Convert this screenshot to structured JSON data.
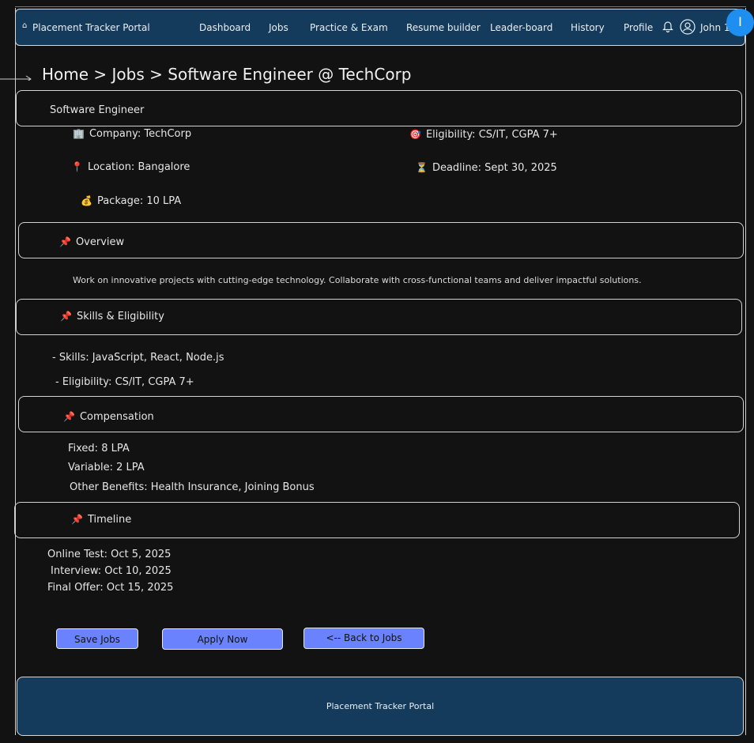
{
  "nav": {
    "brand_icon": "⌂",
    "brand": "Placement Tracker Portal",
    "items": [
      "Dashboard",
      "Jobs",
      "Practice & Exam",
      "Resume builder",
      "Leader-board",
      "History",
      "Profile"
    ],
    "username": "John 1",
    "badge": "I"
  },
  "breadcrumb": "Home > Jobs > Software Engineer @ TechCorp",
  "job": {
    "title": "Software Engineer",
    "company": "Company: TechCorp",
    "location": "Location: Bangalore",
    "package": "Package: 10 LPA",
    "eligibility": "Eligibility: CS/IT, CGPA 7+",
    "deadline": "Deadline: Sept 30, 2025",
    "icons": {
      "company": "🏢",
      "location": "📍",
      "package": "💰",
      "eligibility": "🎯",
      "deadline": "⏳"
    }
  },
  "overview": {
    "title": "Overview",
    "text": "Work on innovative projects with cutting-edge technology. Collaborate with cross-functional teams and deliver impactful solutions."
  },
  "skills": {
    "title": "Skills & Eligibility",
    "items": [
      "-  Skills: JavaScript, React, Node.js",
      "-  Eligibility: CS/IT, CGPA 7+"
    ]
  },
  "compensation": {
    "title": "Compensation",
    "items": [
      "Fixed: 8 LPA",
      "Variable: 2 LPA",
      "Other Benefits: Health Insurance, Joining Bonus"
    ]
  },
  "timeline": {
    "title": "Timeline",
    "items": [
      "Online Test: Oct 5, 2025",
      "Interview: Oct 10, 2025",
      "Final Offer: Oct 15, 2025"
    ]
  },
  "pin_icon": "📌",
  "buttons": {
    "save": "Save Jobs",
    "apply": "Apply Now",
    "back": "<-- Back to Jobs"
  },
  "footer": "Placement Tracker Portal",
  "colors": {
    "nav_bg": "#143b5c",
    "button_bg": "#6b82ff",
    "badge_bg": "#1e8ff0",
    "page_bg": "#121212"
  }
}
